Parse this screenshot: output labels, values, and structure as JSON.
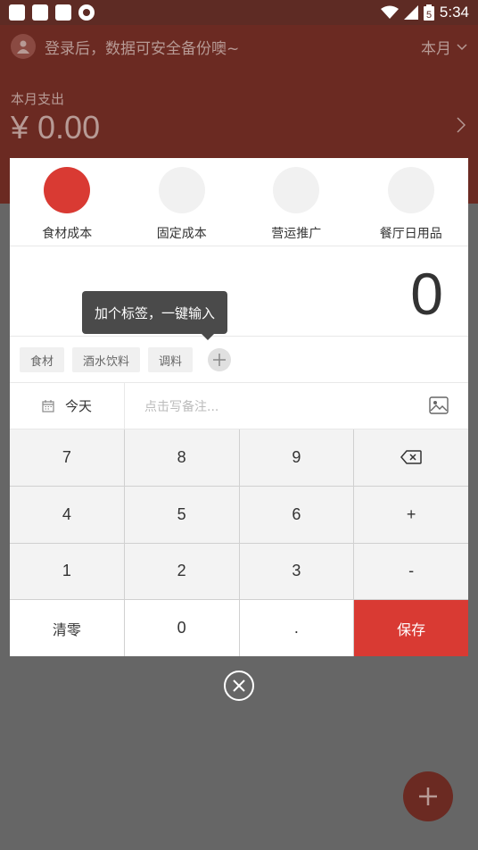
{
  "status_bar": {
    "time": "5:34",
    "battery_level": "5"
  },
  "header": {
    "login_prompt": "登录后，数据可安全备份噢~",
    "period": "本月",
    "expense_label": "本月支出",
    "expense_value": "¥ 0.00"
  },
  "categories": [
    {
      "label": "食材成本",
      "active": true
    },
    {
      "label": "固定成本",
      "active": false
    },
    {
      "label": "营运推广",
      "active": false
    },
    {
      "label": "餐厅日用品",
      "active": false
    }
  ],
  "amount": "0",
  "tooltip": "加个标签，一键输入",
  "tags": [
    "食材",
    "酒水饮料",
    "调料"
  ],
  "date_label": "今天",
  "memo_placeholder": "点击写备注...",
  "keypad": {
    "k7": "7",
    "k8": "8",
    "k9": "9",
    "k4": "4",
    "k5": "5",
    "k6": "6",
    "plus": "+",
    "k1": "1",
    "k2": "2",
    "k3": "3",
    "minus": "-",
    "clear": "清零",
    "k0": "0",
    "dot": ".",
    "save": "保存"
  },
  "colors": {
    "accent": "#d93a33",
    "header_bg": "#6b2a22"
  }
}
